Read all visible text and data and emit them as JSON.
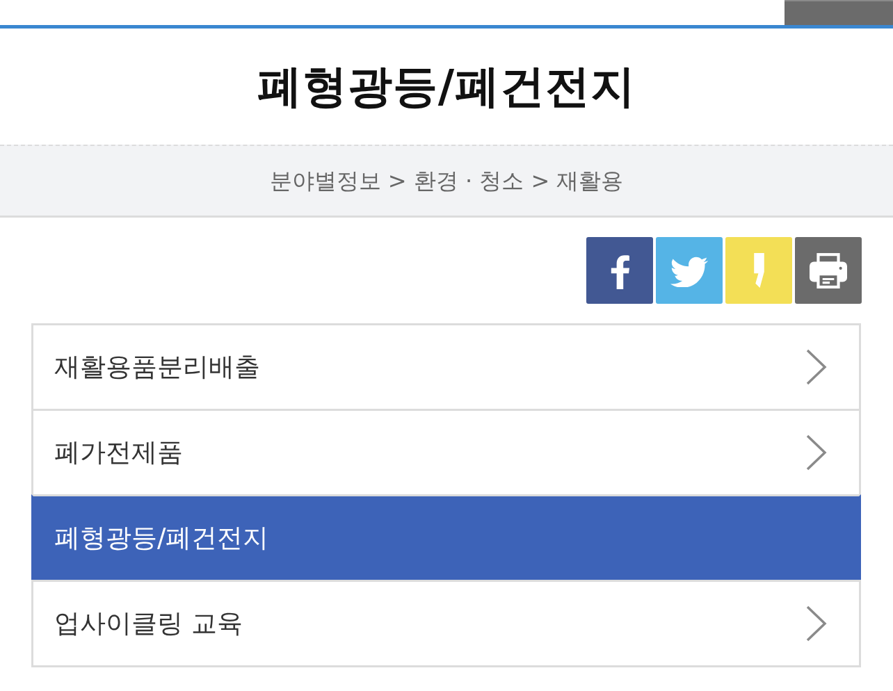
{
  "header": {
    "title": "폐형광등/폐건전지"
  },
  "breadcrumb": "분야별정보 > 환경 · 청소 > 재활용",
  "share_buttons": [
    {
      "kind": "facebook"
    },
    {
      "kind": "twitter"
    },
    {
      "kind": "kakaostory"
    },
    {
      "kind": "print"
    }
  ],
  "menu": [
    {
      "label": "재활용품분리배출",
      "selected": false
    },
    {
      "label": "폐가전제품",
      "selected": false
    },
    {
      "label": "폐형광등/폐건전지",
      "selected": true
    },
    {
      "label": "업사이클링 교육",
      "selected": false
    }
  ]
}
